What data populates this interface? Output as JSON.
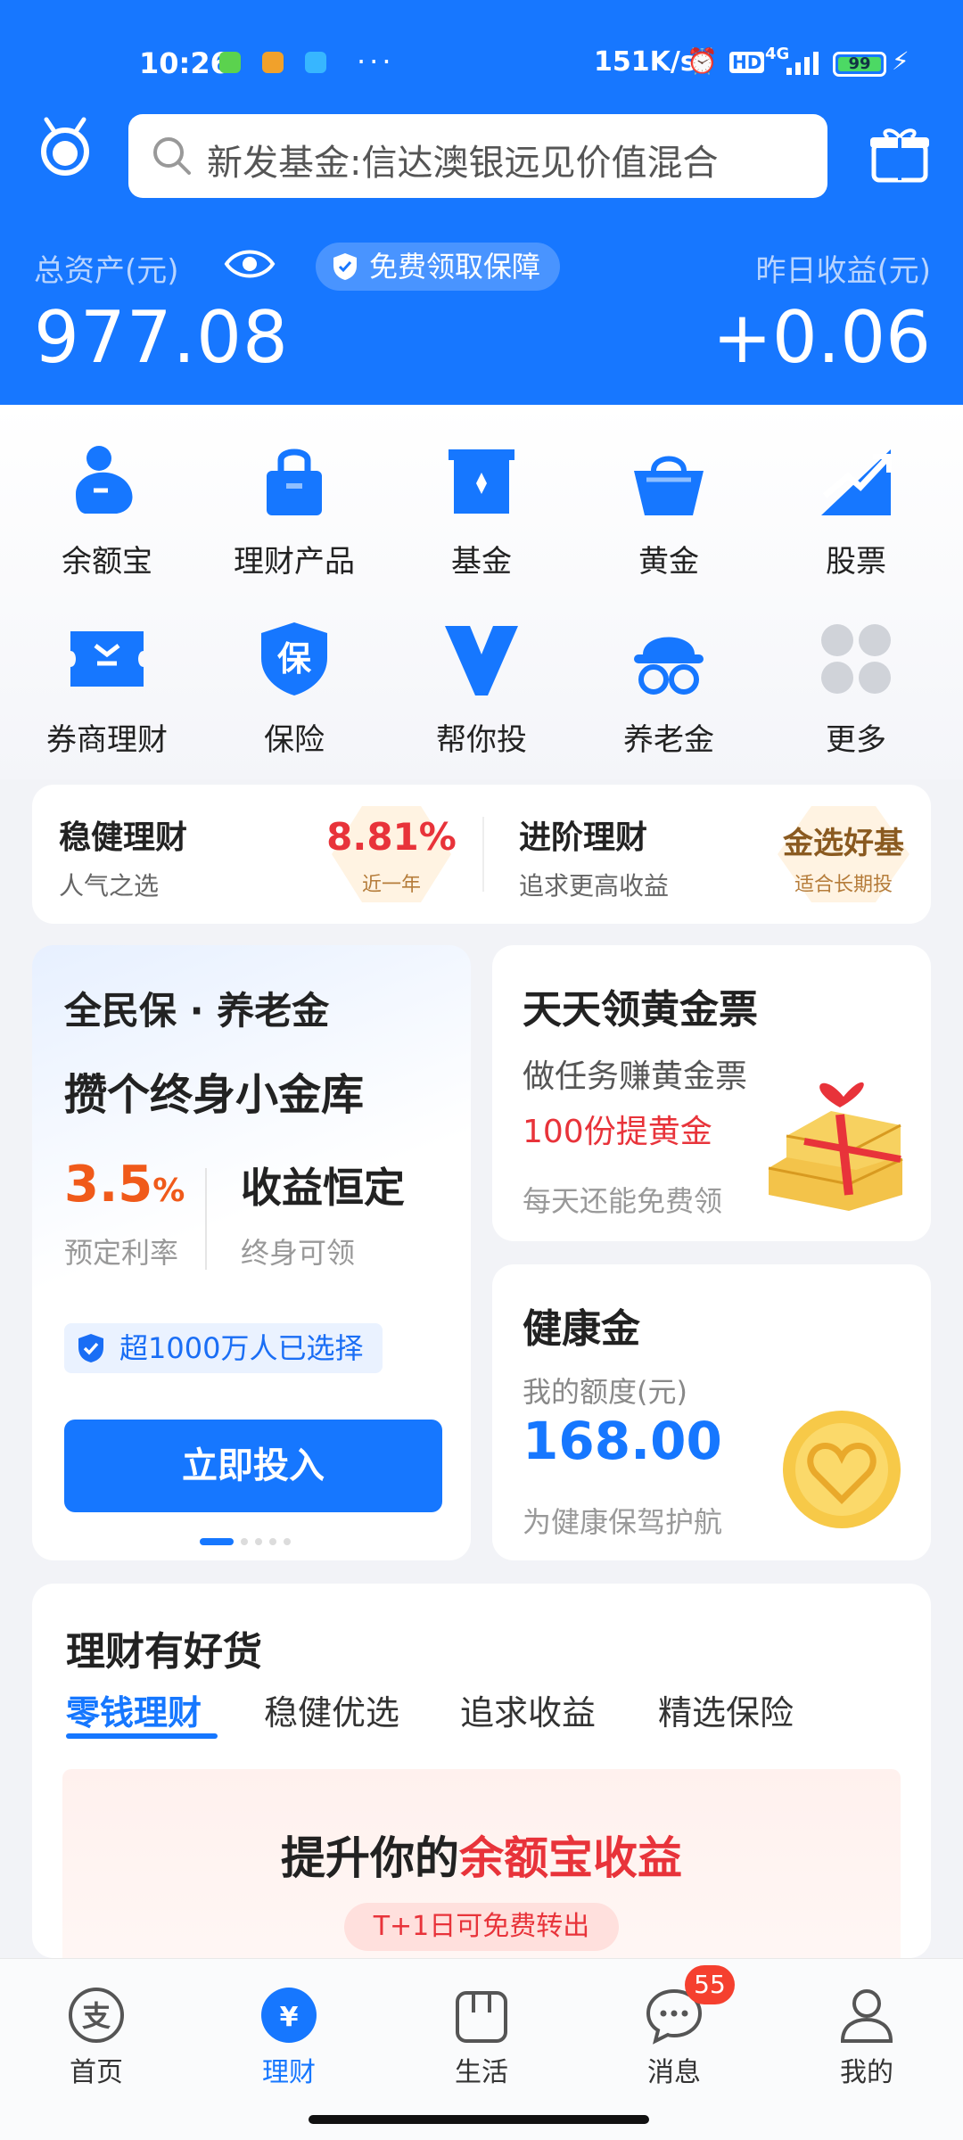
{
  "status_bar": {
    "time": "10:26",
    "more": "···",
    "network_speed": "151K/s",
    "signal_label": "4G",
    "hd_label": "HD",
    "battery": "99"
  },
  "search": {
    "placeholder": "新发基金:信达澳银远见价值混合"
  },
  "assets": {
    "total_label": "总资产(元)",
    "total_value": "977.08",
    "protect_label": "免费领取保障",
    "yesterday_label": "昨日收益(元)",
    "yesterday_value": "+0.06"
  },
  "grid": [
    {
      "label": "余额宝",
      "icon": "yuebao-icon"
    },
    {
      "label": "理财产品",
      "icon": "lock-bag-icon"
    },
    {
      "label": "基金",
      "icon": "fund-box-icon"
    },
    {
      "label": "黄金",
      "icon": "gold-basket-icon"
    },
    {
      "label": "股票",
      "icon": "stock-chart-icon"
    },
    {
      "label": "券商理财",
      "icon": "broker-ticket-icon"
    },
    {
      "label": "保险",
      "icon": "insurance-shield-icon"
    },
    {
      "label": "帮你投",
      "icon": "help-invest-icon"
    },
    {
      "label": "养老金",
      "icon": "pension-icon"
    },
    {
      "label": "更多",
      "icon": "more-dots-icon"
    }
  ],
  "strip": {
    "left_title": "稳健理财",
    "left_sub": "人气之选",
    "left_rate": "8.81%",
    "left_rate_sub": "近一年",
    "right_title": "进阶理财",
    "right_sub": "追求更高收益",
    "right_tag": "金选好基",
    "right_tag_sub": "适合长期投"
  },
  "pension_card": {
    "title": "全民保 · 养老金",
    "headline": "攒个终身小金库",
    "rate": "3.5",
    "rate_unit": "%",
    "rate_label": "预定利率",
    "feature": "收益恒定",
    "feature_label": "终身可领",
    "badge": "超1000万人已选择",
    "button": "立即投入"
  },
  "gold_card": {
    "title": "天天领黄金票",
    "line1": "做任务赚黄金票",
    "line2": "100份提黄金",
    "line3": "每天还能免费领"
  },
  "health_card": {
    "title": "健康金",
    "label": "我的额度(元)",
    "amount": "168.00",
    "footer": "为健康保驾护航"
  },
  "goods": {
    "title": "理财有好货",
    "tabs": [
      "零钱理财",
      "稳健优选",
      "追求收益",
      "精选保险"
    ],
    "banner_title_a": "提升你的",
    "banner_title_b": "余额宝收益",
    "banner_sub": "T+1日可免费转出"
  },
  "nav": [
    {
      "label": "首页",
      "icon": "alipay-home-icon"
    },
    {
      "label": "理财",
      "icon": "wealth-icon"
    },
    {
      "label": "生活",
      "icon": "life-bag-icon"
    },
    {
      "label": "消息",
      "icon": "message-icon"
    },
    {
      "label": "我的",
      "icon": "profile-icon"
    }
  ],
  "message_badge": "55",
  "colors": {
    "brand_blue": "#1677ff",
    "accent_red": "#e8333a",
    "accent_orange": "#f05a1a"
  }
}
